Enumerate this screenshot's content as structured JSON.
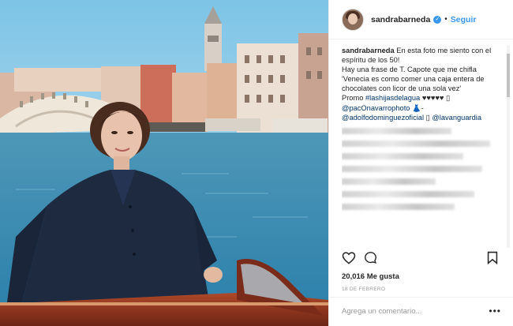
{
  "header": {
    "username": "sandrabarneda",
    "verified_icon": "verified-badge-icon",
    "separator": "•",
    "follow_label": "Seguir"
  },
  "caption": {
    "author": "sandrabarneda",
    "line1": " En esta foto me siento con el espíritu de los 50!",
    "line2": "Hay una frase de T. Capote que me chifla 'Venecia es como comer una caja entera de chocolates con licor de una sola vez'",
    "promo": "Promo ",
    "hashtag": "#lashijasdelagua",
    "hearts": " ♥♥♥♥♥ ▯",
    "mention1": "@pacOnavarrophoto",
    "mention1_suffix": " 👗-",
    "mention2": "@adolfodominguezoficial",
    "mention2_suffix": " ▯ ",
    "mention3": "@lavanguardia"
  },
  "stats": {
    "likes": "20,016 Me gusta",
    "date": "18 DE FEBRERO"
  },
  "comment": {
    "placeholder": "Agrega un comentario...",
    "more": "•••"
  },
  "icons": {
    "like": "heart-icon",
    "comment": "comment-icon",
    "save": "bookmark-icon"
  },
  "colors": {
    "link": "#003569",
    "follow": "#3897f0",
    "muted": "#999999"
  }
}
